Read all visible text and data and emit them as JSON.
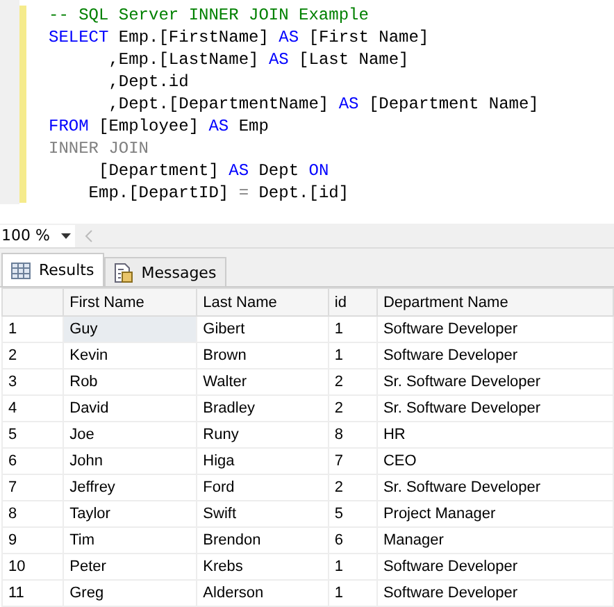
{
  "editor": {
    "lines": [
      [
        {
          "kind": "comment",
          "text": "-- SQL Server INNER JOIN Example"
        }
      ],
      [
        {
          "kind": "keyword",
          "text": "SELECT"
        },
        {
          "kind": "plain",
          "text": " Emp.[FirstName] "
        },
        {
          "kind": "keyword",
          "text": "AS"
        },
        {
          "kind": "plain",
          "text": " [First Name]"
        }
      ],
      [
        {
          "kind": "plain",
          "text": "      ,Emp.[LastName] "
        },
        {
          "kind": "keyword",
          "text": "AS"
        },
        {
          "kind": "plain",
          "text": " [Last Name]"
        }
      ],
      [
        {
          "kind": "plain",
          "text": "      ,Dept.id"
        }
      ],
      [
        {
          "kind": "plain",
          "text": "      ,Dept.[DepartmentName] "
        },
        {
          "kind": "keyword",
          "text": "AS"
        },
        {
          "kind": "plain",
          "text": " [Department Name]"
        }
      ],
      [
        {
          "kind": "keyword",
          "text": "FROM"
        },
        {
          "kind": "plain",
          "text": " [Employee] "
        },
        {
          "kind": "keyword",
          "text": "AS"
        },
        {
          "kind": "plain",
          "text": " Emp"
        }
      ],
      [
        {
          "kind": "operator",
          "text": "INNER JOIN"
        }
      ],
      [
        {
          "kind": "plain",
          "text": "     [Department] "
        },
        {
          "kind": "keyword",
          "text": "AS"
        },
        {
          "kind": "plain",
          "text": " Dept "
        },
        {
          "kind": "keyword",
          "text": "ON"
        }
      ],
      [
        {
          "kind": "plain",
          "text": "    Emp.[DepartID] "
        },
        {
          "kind": "operator",
          "text": "="
        },
        {
          "kind": "plain",
          "text": " Dept.[id]"
        }
      ]
    ]
  },
  "zoom": {
    "value": "100 %"
  },
  "tabs": [
    {
      "label": "Results",
      "selected": true
    },
    {
      "label": "Messages",
      "selected": false
    }
  ],
  "table": {
    "columns": [
      "First Name",
      "Last Name",
      "id",
      "Department Name"
    ],
    "rows": [
      {
        "num": "1",
        "cells": [
          "Guy",
          "Gibert",
          "1",
          "Software Developer"
        ],
        "focused": true
      },
      {
        "num": "2",
        "cells": [
          "Kevin",
          "Brown",
          "1",
          "Software Developer"
        ],
        "focused": false
      },
      {
        "num": "3",
        "cells": [
          "Rob",
          "Walter",
          "2",
          "Sr. Software Developer"
        ],
        "focused": false
      },
      {
        "num": "4",
        "cells": [
          "David",
          "Bradley",
          "2",
          "Sr. Software Developer"
        ],
        "focused": false
      },
      {
        "num": "5",
        "cells": [
          "Joe",
          "Runy",
          "8",
          "HR"
        ],
        "focused": false
      },
      {
        "num": "6",
        "cells": [
          "John",
          "Higa",
          "7",
          "CEO"
        ],
        "focused": false
      },
      {
        "num": "7",
        "cells": [
          "Jeffrey",
          "Ford",
          "2",
          "Sr. Software Developer"
        ],
        "focused": false
      },
      {
        "num": "8",
        "cells": [
          "Taylor",
          "Swift",
          "5",
          "Project Manager"
        ],
        "focused": false
      },
      {
        "num": "9",
        "cells": [
          "Tim",
          "Brendon",
          "6",
          "Manager"
        ],
        "focused": false
      },
      {
        "num": "10",
        "cells": [
          "Peter",
          "Krebs",
          "1",
          "Software Developer"
        ],
        "focused": false
      },
      {
        "num": "11",
        "cells": [
          "Greg",
          "Alderson",
          "1",
          "Software Developer"
        ],
        "focused": false
      }
    ]
  }
}
